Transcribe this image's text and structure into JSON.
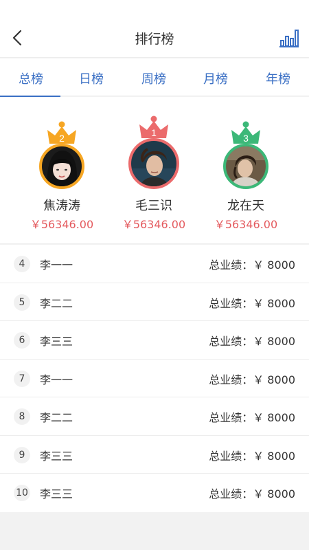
{
  "header": {
    "title": "排行榜",
    "back_icon": "chevron-left-icon",
    "chart_icon": "bar-chart-icon"
  },
  "tabs": [
    {
      "label": "总榜",
      "active": true
    },
    {
      "label": "日榜",
      "active": false
    },
    {
      "label": "周榜",
      "active": false
    },
    {
      "label": "月榜",
      "active": false
    },
    {
      "label": "年榜",
      "active": false
    }
  ],
  "podium": [
    {
      "rank": "2",
      "name": "焦涛涛",
      "amount": "￥56346.00",
      "crown_color": "#f6a623"
    },
    {
      "rank": "1",
      "name": "毛三识",
      "amount": "￥56346.00",
      "crown_color": "#eb6b6c"
    },
    {
      "rank": "3",
      "name": "龙在天",
      "amount": "￥56346.00",
      "crown_color": "#3cb878"
    }
  ],
  "list": [
    {
      "rank": "4",
      "name": "李一一",
      "performance": "总业绩：￥ 8000"
    },
    {
      "rank": "5",
      "name": "李二二",
      "performance": "总业绩：￥ 8000"
    },
    {
      "rank": "6",
      "name": "李三三",
      "performance": "总业绩：￥ 8000"
    },
    {
      "rank": "7",
      "name": "李一一",
      "performance": "总业绩：￥ 8000"
    },
    {
      "rank": "8",
      "name": "李二二",
      "performance": "总业绩：￥ 8000"
    },
    {
      "rank": "9",
      "name": "李三三",
      "performance": "总业绩：￥ 8000"
    },
    {
      "rank": "10",
      "name": "李三三",
      "performance": "总业绩：￥ 8000"
    }
  ],
  "colors": {
    "accent": "#3a6fc4",
    "amount": "#e45a5e",
    "gold": "#f6a623",
    "red": "#eb6b6c",
    "green": "#3cb878"
  }
}
